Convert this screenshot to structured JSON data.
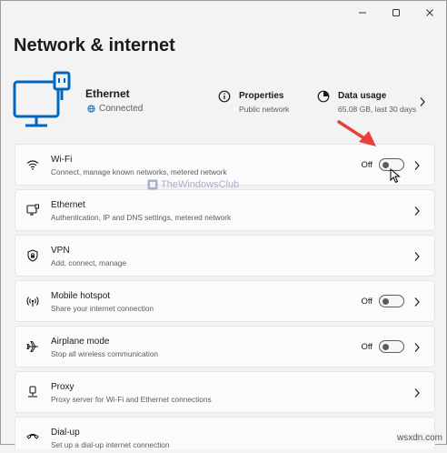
{
  "window": {
    "controls": [
      "minimize-icon",
      "maximize-icon",
      "close-icon"
    ]
  },
  "page": {
    "title": "Network & internet"
  },
  "hero": {
    "connection_name": "Ethernet",
    "connection_status": "Connected",
    "properties": {
      "title": "Properties",
      "subtitle": "Public network"
    },
    "data_usage": {
      "title": "Data usage",
      "subtitle": "65.08 GB, last 30 days"
    }
  },
  "settings": [
    {
      "icon": "wifi-icon",
      "title": "Wi-Fi",
      "subtitle": "Connect, manage known networks, metered network",
      "state": "Off",
      "toggle_on": false
    },
    {
      "icon": "ethernet-icon",
      "title": "Ethernet",
      "subtitle": "Authentication, IP and DNS settings, metered network"
    },
    {
      "icon": "vpn-shield-icon",
      "title": "VPN",
      "subtitle": "Add, connect, manage"
    },
    {
      "icon": "mobile-hotspot-icon",
      "title": "Mobile hotspot",
      "subtitle": "Share your internet connection",
      "state": "Off",
      "toggle_on": false
    },
    {
      "icon": "airplane-icon",
      "title": "Airplane mode",
      "subtitle": "Stop all wireless communication",
      "state": "Off",
      "toggle_on": false
    },
    {
      "icon": "proxy-icon",
      "title": "Proxy",
      "subtitle": "Proxy server for Wi-Fi and Ethernet connections"
    },
    {
      "icon": "dial-up-icon",
      "title": "Dial-up",
      "subtitle": "Set up a dial-up internet connection"
    }
  ],
  "watermark": "TheWindowsClub",
  "site_label": "wsxdn.com",
  "colors": {
    "accent": "#0067c0",
    "annotation_arrow": "#e8403a",
    "background": "#f3f3f3",
    "card": "#fbfbfb"
  }
}
